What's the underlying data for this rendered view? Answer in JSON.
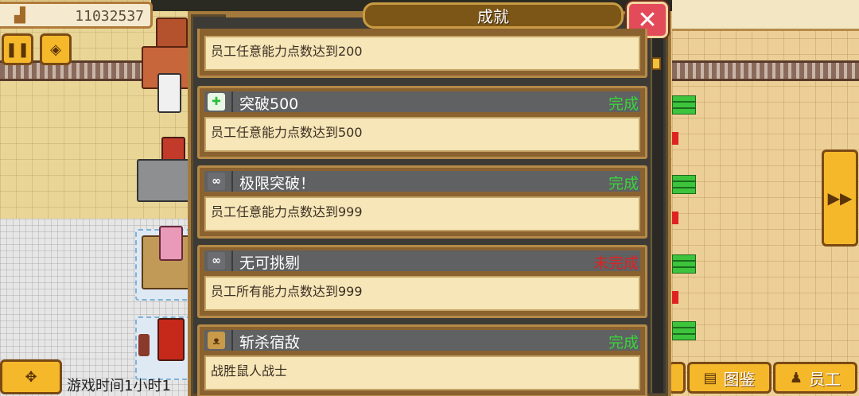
{
  "hud": {
    "money_value": "11032537",
    "money_icon": "building-icon",
    "pause_icon": "pause-icon",
    "speed_icon": "speed-icon",
    "move_icon": "move-icon",
    "side_arrow_icon": "fast-forward-icon",
    "game_time": "游戏时间1小时1"
  },
  "bottom_nav": {
    "encyclopedia_label": "图鉴",
    "encyclopedia_icon": "book-icon",
    "staff_label": "员工",
    "staff_icon": "staff-icon"
  },
  "dialog": {
    "title": "成就",
    "close_icon": "close-icon",
    "colors": {
      "done": "#3ad43a",
      "undone": "#e02020"
    },
    "achievements": [
      {
        "name": "",
        "status": "",
        "description": "员工任意能力点数达到200",
        "icon": ""
      },
      {
        "name": "突破500",
        "status": "完成",
        "description": "员工任意能力点数达到500",
        "icon": "green-cross-icon"
      },
      {
        "name": "极限突破！",
        "status": "完成",
        "description": "员工任意能力点数达到999",
        "icon": "chain-icon"
      },
      {
        "name": "无可挑剔",
        "status": "未完成",
        "description": "员工所有能力点数达到999",
        "icon": "chain-icon"
      },
      {
        "name": "斩杀宿敌",
        "status": "完成",
        "description": "战胜鼠人战士",
        "icon": "rat-icon"
      }
    ]
  }
}
